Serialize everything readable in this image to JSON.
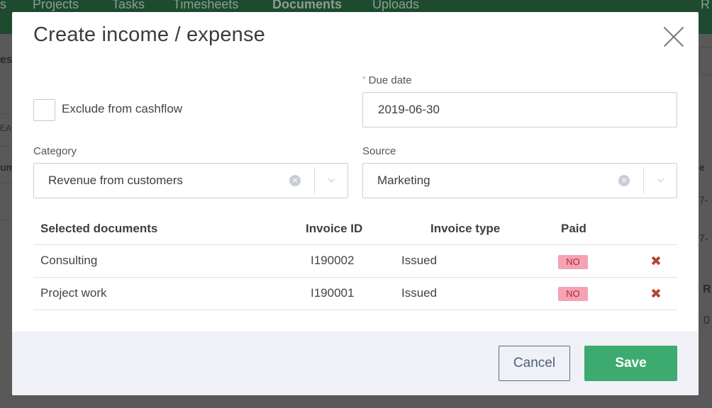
{
  "background": {
    "nav": [
      "s",
      "Projects",
      "Tasks",
      "Timesheets",
      "Documents",
      "Uploads",
      "R"
    ],
    "fragments": [
      "es",
      "EA",
      "um",
      "e",
      "7-",
      "7-",
      "R",
      "0"
    ]
  },
  "modal": {
    "title": "Create income / expense",
    "exclude_cashflow_label": "Exclude from cashflow",
    "due_date": {
      "required_mark": "*",
      "label": "Due date",
      "value": "2019-06-30"
    },
    "category": {
      "label": "Category",
      "value": "Revenue from customers"
    },
    "source": {
      "label": "Source",
      "value": "Marketing"
    },
    "table": {
      "headers": [
        "Selected documents",
        "Invoice ID",
        "Invoice type",
        "Paid"
      ],
      "rows": [
        {
          "name": "Consulting",
          "invoice_id": "I190002",
          "type": "Issued",
          "paid": "NO"
        },
        {
          "name": "Project work",
          "invoice_id": "I190001",
          "type": "Issued",
          "paid": "NO"
        }
      ]
    },
    "footer": {
      "cancel_label": "Cancel",
      "save_label": "Save"
    }
  },
  "colors": {
    "accent_green": "#3dab6f",
    "paid_no_badge": "#f3a3b1",
    "remove_icon": "#b74336",
    "cancel_border": "#5b6a8c"
  }
}
